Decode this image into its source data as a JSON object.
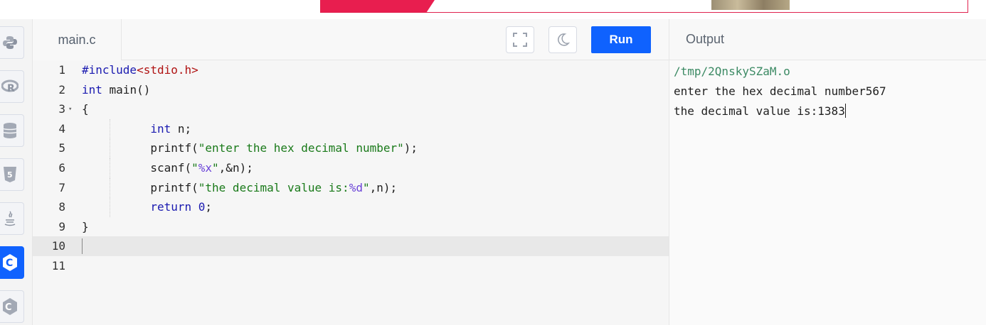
{
  "editor": {
    "tab_label": "main.c",
    "run_label": "Run",
    "fullscreen_icon": "fullscreen-icon",
    "theme_icon": "moon-icon",
    "lines": [
      {
        "n": "1",
        "html": "<span class=\"kw\">#include</span><span class=\"inc\">&lt;stdio.h&gt;</span>"
      },
      {
        "n": "2",
        "html": "<span class=\"kw\">int</span> main()"
      },
      {
        "n": "3",
        "fold": "▾",
        "html": "{"
      },
      {
        "n": "4",
        "html": "          <span class=\"kw\">int</span> n;"
      },
      {
        "n": "5",
        "html": "          printf(<span class=\"str\">\"enter the hex decimal number\"</span>);"
      },
      {
        "n": "6",
        "html": "          scanf(<span class=\"str\">\"</span><span class=\"fmt\">%x</span><span class=\"str\">\"</span>,&amp;n);"
      },
      {
        "n": "7",
        "html": "          printf(<span class=\"str\">\"the decimal value is:</span><span class=\"fmt\">%d</span><span class=\"str\">\"</span>,n);"
      },
      {
        "n": "8",
        "html": "          <span class=\"kw\">return</span> <span class=\"num\">0</span>;"
      },
      {
        "n": "9",
        "html": "}"
      },
      {
        "n": "10",
        "html": "",
        "highlight": true
      },
      {
        "n": "11",
        "html": ""
      }
    ]
  },
  "output": {
    "title": "Output",
    "path": "/tmp/2QnskySZaM.o",
    "lines": [
      "enter the hex decimal number567",
      "the decimal value is:1383"
    ]
  },
  "sidebar": {
    "items": [
      {
        "name": "python-icon",
        "active": false
      },
      {
        "name": "r-language-icon",
        "active": false
      },
      {
        "name": "database-icon",
        "active": false
      },
      {
        "name": "html5-icon",
        "active": false
      },
      {
        "name": "java-icon",
        "active": false
      },
      {
        "name": "c-language-icon",
        "active": true
      },
      {
        "name": "cpp-language-icon",
        "active": false
      }
    ]
  },
  "colors": {
    "accent": "#0f62fe",
    "ad_red": "#e81e4f"
  }
}
